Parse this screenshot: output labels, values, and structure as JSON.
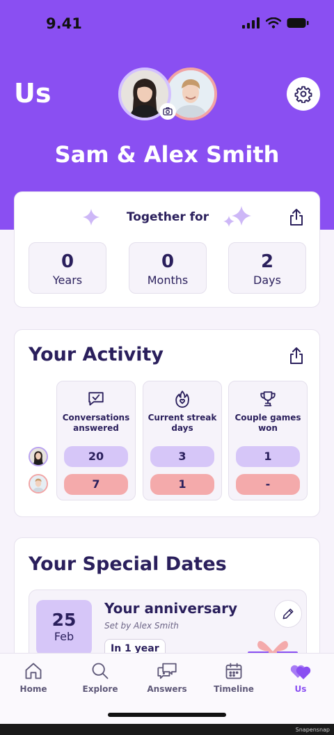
{
  "status_bar": {
    "time": "9.41"
  },
  "header": {
    "title": "Us",
    "couple_name": "Sam & Alex Smith"
  },
  "together": {
    "title": "Together for",
    "stats": [
      {
        "value": "0",
        "label": "Years"
      },
      {
        "value": "0",
        "label": "Months"
      },
      {
        "value": "2",
        "label": "Days"
      }
    ]
  },
  "activity": {
    "title": "Your Activity",
    "columns": [
      {
        "label": "Conversations answered",
        "icon": "chat-check-icon",
        "user_a": "20",
        "user_b": "7"
      },
      {
        "label": "Current streak days",
        "icon": "flame-heart-icon",
        "user_a": "3",
        "user_b": "1"
      },
      {
        "label": "Couple games won",
        "icon": "trophy-icon",
        "user_a": "1",
        "user_b": "-"
      }
    ]
  },
  "special_dates": {
    "title": "Your Special Dates",
    "items": [
      {
        "day": "25",
        "month": "Feb",
        "title": "Your anniversary",
        "subtitle": "Set by Alex Smith",
        "chip": "In 1 year"
      }
    ]
  },
  "tabs": [
    {
      "label": "Home",
      "icon": "home-icon"
    },
    {
      "label": "Explore",
      "icon": "magnifier-icon"
    },
    {
      "label": "Answers",
      "icon": "chat-bubbles-icon"
    },
    {
      "label": "Timeline",
      "icon": "calendar-icon"
    },
    {
      "label": "Us",
      "icon": "hearts-icon",
      "active": true
    }
  ],
  "watermark": "Snapensnap",
  "colors": {
    "brand": "#8a4ff2",
    "partner_a": "#d6c6f8",
    "partner_b": "#f4aaab",
    "text": "#2a1f5c"
  }
}
